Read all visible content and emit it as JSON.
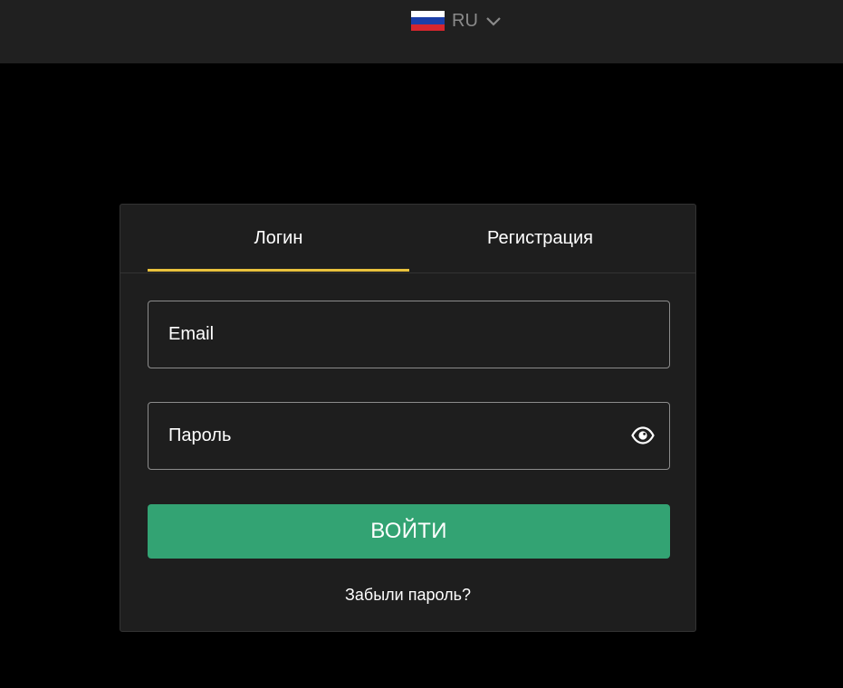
{
  "header": {
    "language": {
      "code": "RU",
      "flag_colors": [
        "#ffffff",
        "#1c3fa8",
        "#d6262e"
      ],
      "icon": "russia-flag-icon",
      "dropdown_icon": "chevron-down-icon"
    }
  },
  "auth": {
    "tabs": [
      {
        "label": "Логин",
        "active": true
      },
      {
        "label": "Регистрация",
        "active": false
      }
    ],
    "email": {
      "placeholder": "Email",
      "value": ""
    },
    "password": {
      "placeholder": "Пароль",
      "value": "",
      "toggle_icon": "eye-icon"
    },
    "submit_label": "ВОЙТИ",
    "forgot_label": "Забыли пароль?"
  },
  "colors": {
    "background": "#000000",
    "topbar": "#202020",
    "card": "#1e1e1e",
    "accent": "#e8c13c",
    "button": "#33a373"
  }
}
